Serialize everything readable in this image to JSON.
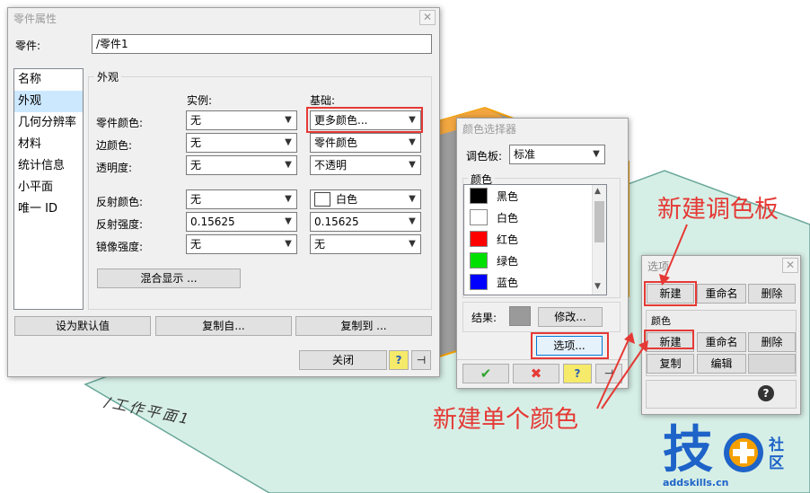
{
  "part_window": {
    "title": "零件属性",
    "close_glyph": "✕",
    "part_label": "零件:",
    "part_value": "/零件1",
    "nav_items": [
      "名称",
      "外观",
      "几何分辨率",
      "材料",
      "统计信息",
      "小平面",
      "唯一 ID"
    ],
    "selected_nav": "外观",
    "appearance_group": "外观",
    "col_instance": "实例:",
    "col_base": "基础:",
    "rows": [
      {
        "label": "零件颜色:",
        "instance": "无",
        "base": "更多颜色..."
      },
      {
        "label": "边颜色:",
        "instance": "无",
        "base": "零件颜色"
      },
      {
        "label": "透明度:",
        "instance": "无",
        "base": "不透明"
      },
      {
        "label": "反射颜色:",
        "instance": "无",
        "base": "白色"
      },
      {
        "label": "反射强度:",
        "instance": "0.15625",
        "base": "0.15625"
      },
      {
        "label": "镜像强度:",
        "instance": "无",
        "base": "无"
      }
    ],
    "blend_button": "混合显示 ...",
    "set_default_button": "设为默认值",
    "copy_from_button": "复制自...",
    "copy_to_button": "复制到 ...",
    "close_button": "关闭",
    "help_glyph": "?",
    "pin_glyph": "⊣"
  },
  "color_picker": {
    "title": "颜色选择器",
    "palette_label": "调色板:",
    "palette_value": "标准",
    "colors_group": "颜色",
    "colors": [
      {
        "name": "黑色",
        "hex": "#000000"
      },
      {
        "name": "白色",
        "hex": "#ffffff"
      },
      {
        "name": "红色",
        "hex": "#ff0000"
      },
      {
        "name": "绿色",
        "hex": "#00e000"
      },
      {
        "name": "蓝色",
        "hex": "#0000ff"
      }
    ],
    "result_label": "结果:",
    "result_color": "#9a9a9a",
    "modify_button": "修改...",
    "options_button": "选项...",
    "ok_glyph": "✔",
    "cancel_glyph": "✖",
    "help_glyph": "?",
    "pin_glyph": "⊣"
  },
  "options_window": {
    "title": "选项",
    "close_glyph": "✕",
    "palette_buttons": [
      "新建",
      "重命名",
      "删除"
    ],
    "color_group": "颜色",
    "color_buttons_row1": [
      "新建",
      "重命名",
      "删除"
    ],
    "color_buttons_row2": [
      "复制",
      "编辑"
    ],
    "help_glyph": "?"
  },
  "annotations": {
    "new_palette": "新建调色板",
    "new_color": "新建单个颜色"
  },
  "watermark": {
    "big_char": "技",
    "small_chars": "社区",
    "url": "addskills.cn"
  },
  "scene": {
    "plane_label": "/工作平面1"
  },
  "colors": {
    "accent_red": "#e53935",
    "selection_blue": "#cce8ff",
    "plane_fill": "#d6efe6",
    "watermark_blue": "#1e63c8",
    "watermark_orange": "#f5a000"
  }
}
